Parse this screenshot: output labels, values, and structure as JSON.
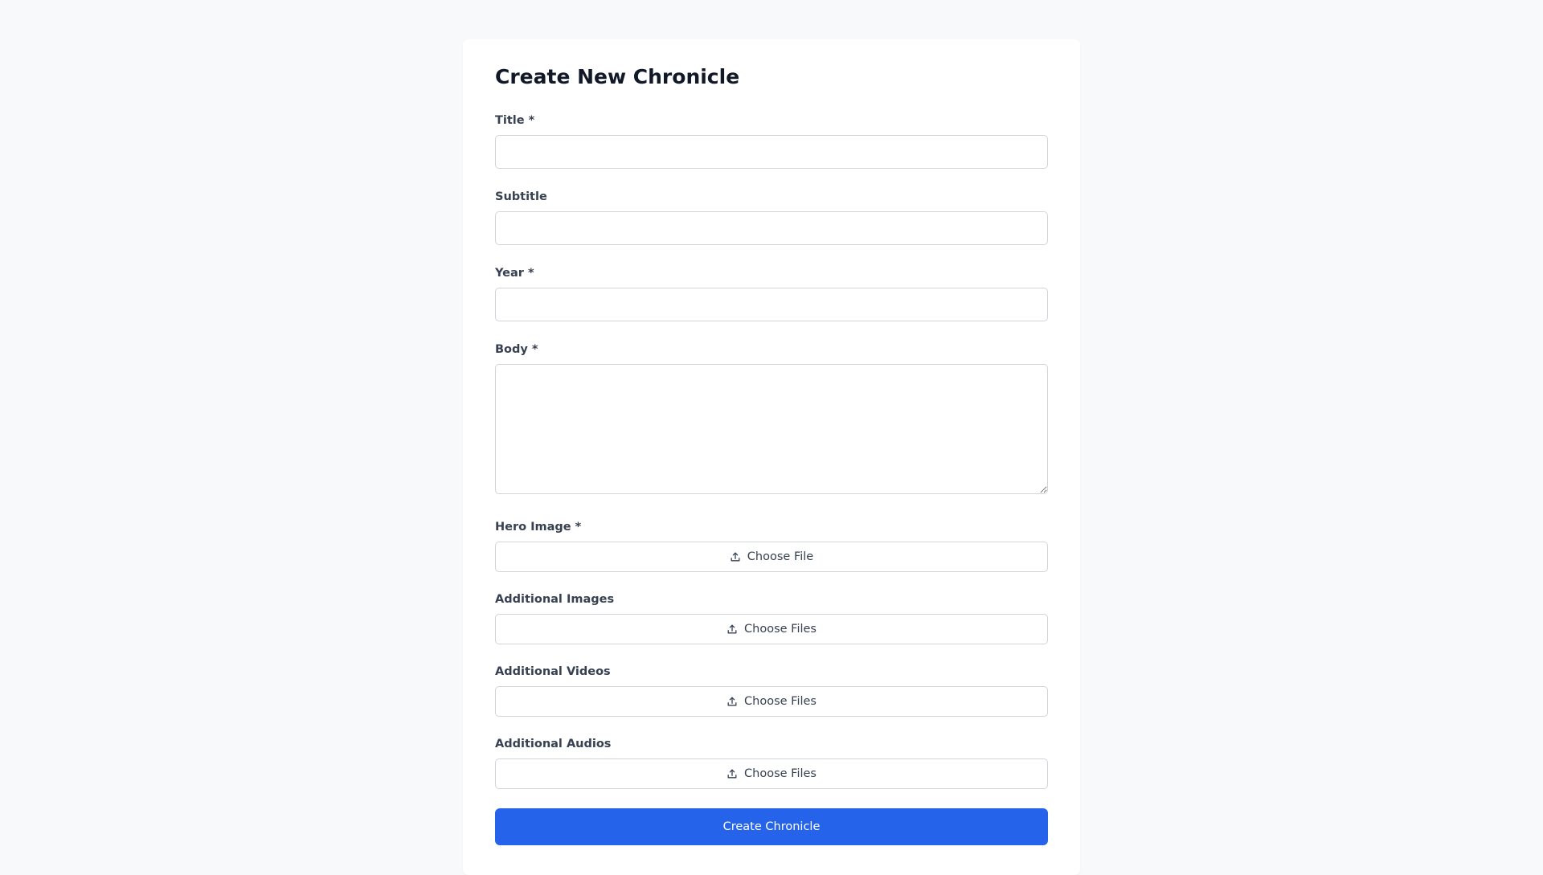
{
  "form": {
    "title": "Create New Chronicle",
    "fields": {
      "title": {
        "label": "Title *",
        "value": ""
      },
      "subtitle": {
        "label": "Subtitle",
        "value": ""
      },
      "year": {
        "label": "Year *",
        "value": ""
      },
      "body": {
        "label": "Body *",
        "value": ""
      }
    },
    "uploads": {
      "hero_image": {
        "label": "Hero Image *",
        "button": "Choose File",
        "icon": "upload-icon"
      },
      "additional_images": {
        "label": "Additional Images",
        "button": "Choose Files",
        "icon": "upload-icon"
      },
      "additional_videos": {
        "label": "Additional Videos",
        "button": "Choose Files",
        "icon": "upload-icon"
      },
      "additional_audios": {
        "label": "Additional Audios",
        "button": "Choose Files",
        "icon": "upload-icon"
      }
    },
    "submit_label": "Create Chronicle"
  },
  "colors": {
    "background": "#f8f9fb",
    "card": "#ffffff",
    "accent": "#2563eb",
    "border": "#d1d5db",
    "label": "#374151"
  }
}
